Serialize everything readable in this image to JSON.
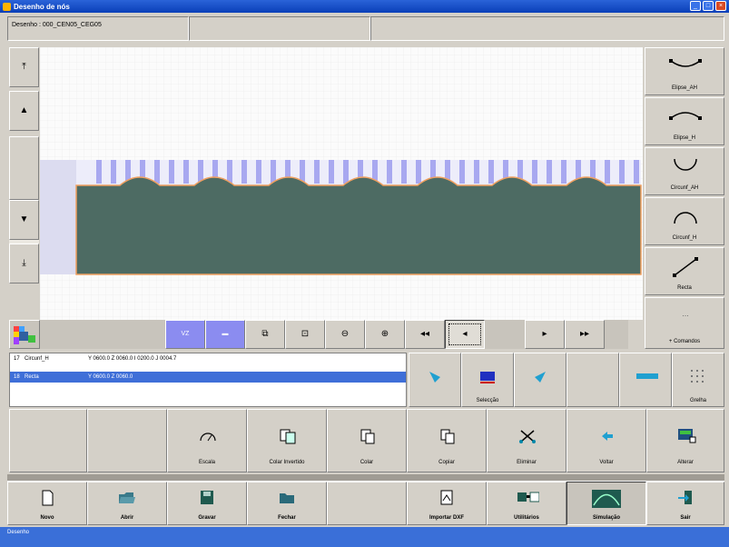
{
  "window": {
    "title": "Desenho de nós"
  },
  "infobar": {
    "drawing_label": "Desenho : 000_CEN05_CEG05"
  },
  "toolstrip": {
    "selected_label": "VZ"
  },
  "list": {
    "rows": [
      {
        "index": "17",
        "name": "Circunf_H",
        "values": "Y 0600.0  Z 0060.0  I 0200.0  J 0004.7"
      },
      {
        "index": "18",
        "name": "Recta",
        "values": "Y 0600.0  Z 0060.0"
      }
    ]
  },
  "right_panel": {
    "buttons": [
      {
        "label": "Elipse_AH",
        "icon": "arc-up-icon"
      },
      {
        "label": "Elipse_H",
        "icon": "arc-down-icon"
      },
      {
        "label": "Circunf_AH",
        "icon": "half-circle-up-icon"
      },
      {
        "label": "Circunf_H",
        "icon": "half-circle-down-icon"
      },
      {
        "label": "Recta",
        "icon": "line-icon"
      },
      {
        "label": "+ Comandos",
        "icon": "dots-icon"
      }
    ]
  },
  "mid_panel": {
    "buttons": [
      {
        "label": ""
      },
      {
        "label": "Selecção"
      },
      {
        "label": ""
      },
      {
        "label": ""
      },
      {
        "label": ""
      },
      {
        "label": "Grelha"
      }
    ]
  },
  "edit_bar": {
    "buttons": [
      {
        "label": ""
      },
      {
        "label": ""
      },
      {
        "label": "Escala"
      },
      {
        "label": "Colar Invertido"
      },
      {
        "label": "Colar"
      },
      {
        "label": "Copiar"
      },
      {
        "label": "Eliminar"
      },
      {
        "label": "Voltar"
      },
      {
        "label": "Alterar"
      }
    ]
  },
  "main_bar": {
    "buttons": [
      {
        "label": "Novo"
      },
      {
        "label": "Abrir"
      },
      {
        "label": "Gravar"
      },
      {
        "label": "Fechar"
      },
      {
        "label": ""
      },
      {
        "label": "Importar DXF"
      },
      {
        "label": "Utilitários"
      },
      {
        "label": "Simulação"
      },
      {
        "label": "Sair"
      }
    ]
  },
  "status": {
    "text": "Desenho"
  },
  "colors": {
    "profile_fill": "#4d6b63",
    "profile_edge": "#f0a060",
    "selection": "#3f6fd8",
    "tool_selected": "#8b8cf0"
  }
}
